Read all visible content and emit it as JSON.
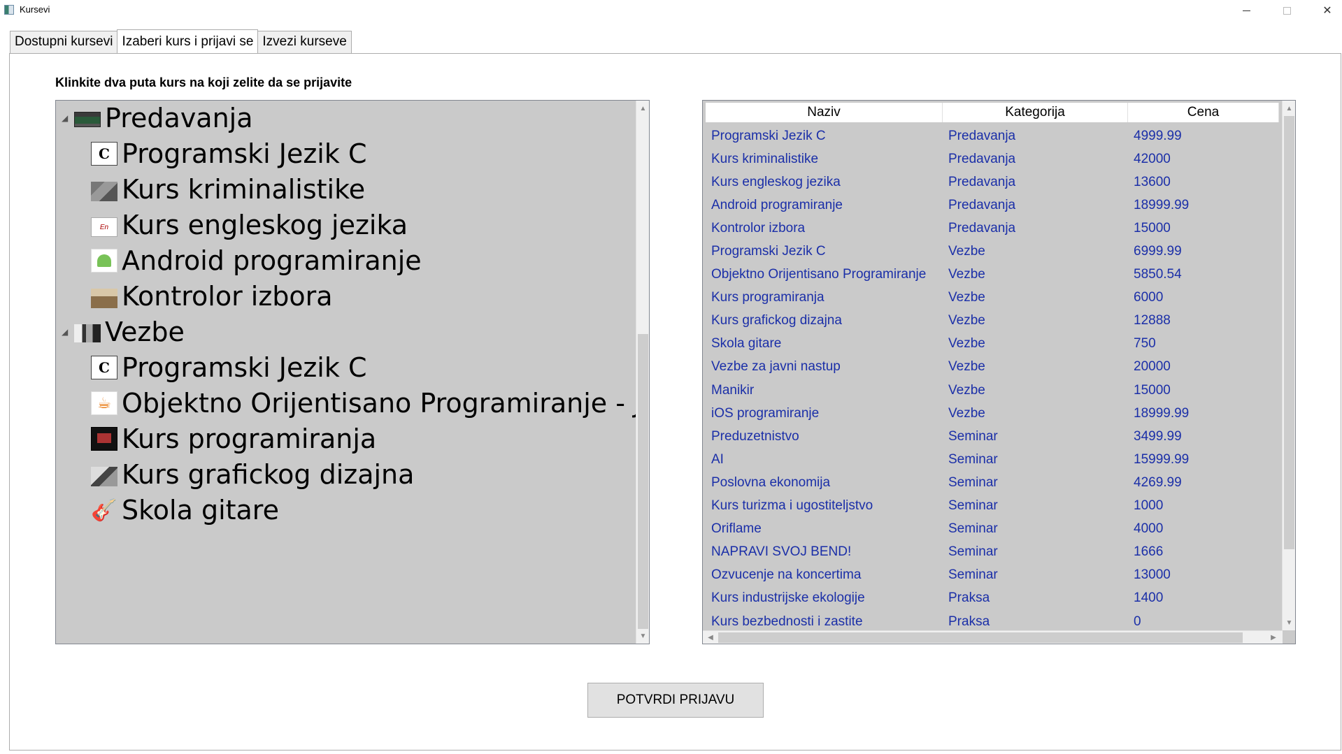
{
  "window": {
    "title": "Kursevi"
  },
  "tabs": [
    {
      "label": "Dostupni kursevi"
    },
    {
      "label": "Izaberi kurs i prijavi se"
    },
    {
      "label": "Izvezi kurseve"
    }
  ],
  "instruction": "Klinkite dva puta kurs na koji zelite da se prijavite",
  "tree": {
    "groups": [
      {
        "label": "Predavanja",
        "icon": "lecture-icon",
        "children": [
          {
            "label": "Programski Jezik C",
            "icon": "c-language-icon"
          },
          {
            "label": "Kurs kriminalistike",
            "icon": "criminalistics-icon"
          },
          {
            "label": "Kurs engleskog jezika",
            "icon": "english-icon"
          },
          {
            "label": "Android programiranje",
            "icon": "android-icon"
          },
          {
            "label": "Kontrolor izbora",
            "icon": "election-control-icon"
          }
        ]
      },
      {
        "label": "Vezbe",
        "icon": "exercises-icon",
        "children": [
          {
            "label": "Programski Jezik C",
            "icon": "c-language-icon"
          },
          {
            "label": "Objektno Orijentisano Programiranje - Java",
            "icon": "java-icon"
          },
          {
            "label": "Kurs programiranja",
            "icon": "programming-icon"
          },
          {
            "label": "Kurs grafickog dizajna",
            "icon": "graphic-design-icon"
          },
          {
            "label": "Skola gitare",
            "icon": "guitar-icon"
          }
        ]
      }
    ]
  },
  "grid": {
    "columns": [
      "Naziv",
      "Kategorija",
      "Cena"
    ],
    "rows": [
      [
        "Programski Jezik C",
        "Predavanja",
        "4999.99"
      ],
      [
        "Kurs kriminalistike",
        "Predavanja",
        "42000"
      ],
      [
        "Kurs engleskog jezika",
        "Predavanja",
        "13600"
      ],
      [
        "Android programiranje",
        "Predavanja",
        "18999.99"
      ],
      [
        "Kontrolor izbora",
        "Predavanja",
        "15000"
      ],
      [
        "Programski Jezik C",
        "Vezbe",
        "6999.99"
      ],
      [
        "Objektno Orijentisano Programiranje",
        "Vezbe",
        "5850.54"
      ],
      [
        "Kurs programiranja",
        "Vezbe",
        "6000"
      ],
      [
        "Kurs grafickog dizajna",
        "Vezbe",
        "12888"
      ],
      [
        "Skola gitare",
        "Vezbe",
        "750"
      ],
      [
        "Vezbe za javni nastup",
        "Vezbe",
        "20000"
      ],
      [
        "Manikir",
        "Vezbe",
        "15000"
      ],
      [
        "iOS programiranje",
        "Vezbe",
        "18999.99"
      ],
      [
        "Preduzetnistvo",
        "Seminar",
        "3499.99"
      ],
      [
        "AI",
        "Seminar",
        "15999.99"
      ],
      [
        "Poslovna ekonomija",
        "Seminar",
        "4269.99"
      ],
      [
        "Kurs turizma i ugostiteljstvo",
        "Seminar",
        "1000"
      ],
      [
        "Oriflame",
        "Seminar",
        "4000"
      ],
      [
        "NAPRAVI SVOJ BEND!",
        "Seminar",
        "1666"
      ],
      [
        "Ozvucenje na koncertima",
        "Seminar",
        "13000"
      ],
      [
        "Kurs industrijske ekologije",
        "Praksa",
        "1400"
      ],
      [
        "Kurs bezbednosti i zastite",
        "Praksa",
        "0"
      ]
    ]
  },
  "confirm_button": "POTVRDI PRIJAVU",
  "colors": {
    "panel_bg": "#cacaca",
    "grid_text": "#1b2fa8"
  }
}
